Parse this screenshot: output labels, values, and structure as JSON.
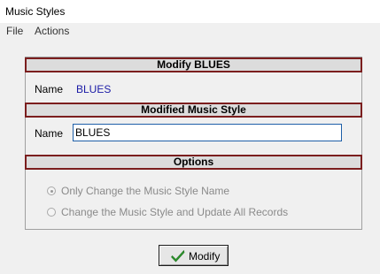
{
  "window": {
    "title": "Music Styles"
  },
  "menu": {
    "file": "File",
    "actions": "Actions"
  },
  "modify_section": {
    "header": "Modify BLUES",
    "name_label": "Name",
    "name_value": "BLUES"
  },
  "modified_section": {
    "header": "Modified Music Style",
    "name_label": "Name",
    "name_input_value": "BLUES"
  },
  "options_section": {
    "header": "Options",
    "option_1": "Only Change the Music Style Name",
    "option_2": "Change the Music Style and Update All Records",
    "selected_option": 1
  },
  "button": {
    "modify_label": "Modify",
    "icon": "checkmark-icon"
  },
  "colors": {
    "section_border": "#7b1e1e",
    "name_value": "#1a1aa6",
    "check_green": "#2e9e2e"
  }
}
